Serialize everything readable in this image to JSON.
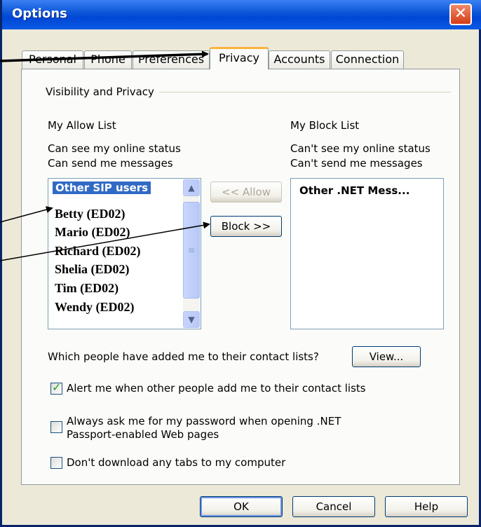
{
  "window": {
    "title": "Options",
    "close_glyph": "✕"
  },
  "tabs": [
    {
      "label": "Personal",
      "active": false
    },
    {
      "label": "Phone",
      "active": false
    },
    {
      "label": "Preferences",
      "active": false
    },
    {
      "label": "Privacy",
      "active": true
    },
    {
      "label": "Accounts",
      "active": false
    },
    {
      "label": "Connection",
      "active": false
    }
  ],
  "privacy": {
    "group_title": "Visibility and Privacy",
    "allow": {
      "heading": "My Allow List",
      "desc1": "Can see my online status",
      "desc2": "Can send me messages",
      "items": [
        "Other SIP users",
        "Betty (ED02)",
        "Mario (ED02)",
        "Richard (ED02)",
        "Shelia (ED02)",
        "Tim (ED02)",
        "Wendy (ED02)"
      ]
    },
    "block": {
      "heading": "My Block List",
      "desc1": "Can't see my online status",
      "desc2": "Can't send me messages",
      "items": [
        "Other .NET Mess..."
      ]
    },
    "allow_button": "<< Allow",
    "block_button": "Block >>",
    "contacts_question": "Which people have added me to their contact lists?",
    "view_button": "View...",
    "options": [
      {
        "label": "Alert me when other people add me to their contact lists",
        "checked": true
      },
      {
        "label_line1": "Always ask me for my password when opening .NET",
        "label_line2": "Passport-enabled Web pages",
        "checked": false
      },
      {
        "label": "Don't download any tabs to my computer",
        "checked": false
      }
    ]
  },
  "footer": {
    "ok": "OK",
    "cancel": "Cancel",
    "help": "Help"
  },
  "icons": {
    "scroll_up": "chevron-up-icon",
    "scroll_down": "chevron-down-icon",
    "check": "checkmark-icon"
  },
  "colors": {
    "titlebar": "#0a53d6",
    "selection": "#316ac5",
    "tab_highlight": "#f9b43a",
    "close": "#d63c15"
  }
}
